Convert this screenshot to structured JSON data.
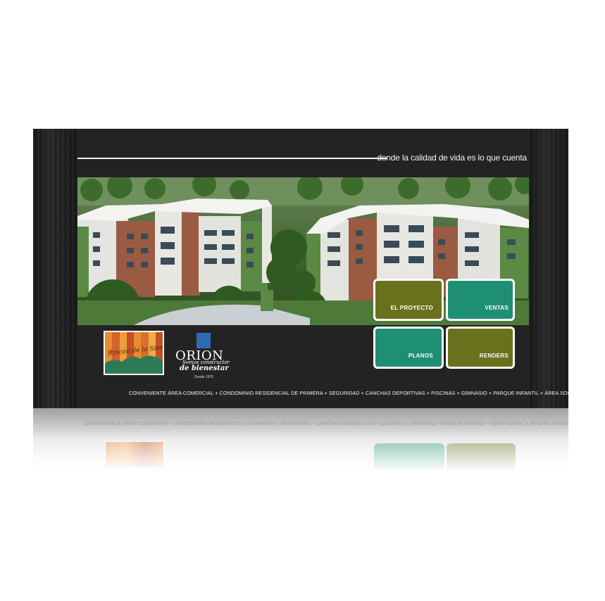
{
  "header": {
    "tagline": "donde la calidad de vida es lo que cuenta"
  },
  "hero": {
    "image_icon": "apartment-buildings-rendering"
  },
  "menu": {
    "items": [
      {
        "label": "EL PROYECTO",
        "color": "#6a711d"
      },
      {
        "label": "VENTAS",
        "color": "#1e8f72"
      },
      {
        "label": "PLANOS",
        "color": "#1e8f72"
      },
      {
        "label": "RENDERS",
        "color": "#6a711d"
      }
    ]
  },
  "logos": {
    "project": {
      "script_text": "Rincón de la Sierra"
    },
    "company": {
      "name": "ORION",
      "slogan_line1": "Somos constructor",
      "slogan_line2": "de bienestar",
      "since": "Desde 1976"
    }
  },
  "footer": {
    "features": "CONVENIENTE ÁREA COMERCIAL + CONDOMINIO RESIDENCIAL DE PRIMERA + SEGURIDAD + CANCHAS DEPORTIVAS + PISCINAS + GIMNASIO + PARQUE INFANTIL + ÁREA SOCIAL + MUCHO VERDE"
  },
  "colors": {
    "background": "#1d1d1d",
    "olive": "#6a711d",
    "teal": "#1e8f72",
    "orion_blue": "#2f6db3"
  }
}
